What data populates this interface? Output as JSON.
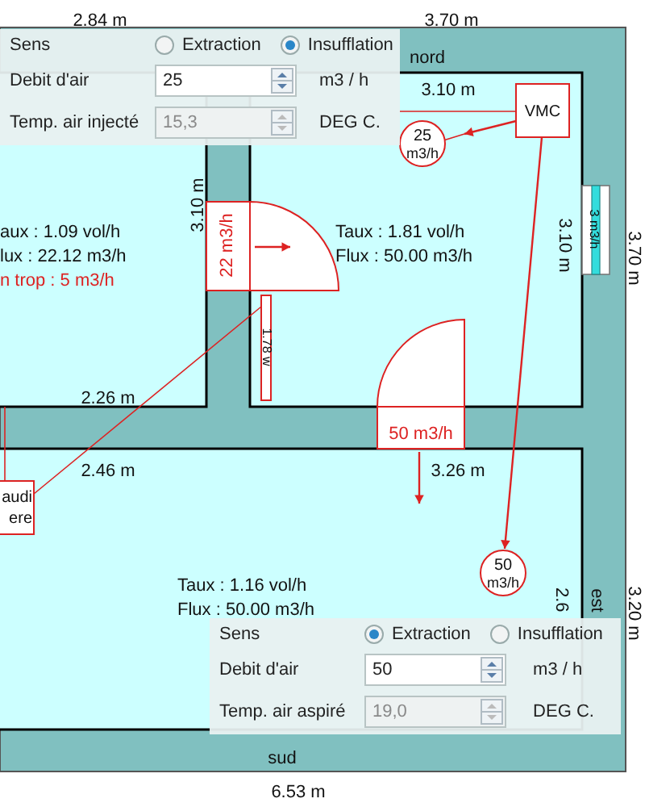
{
  "plan": {
    "dimension_labels": [
      "2.84 m",
      "3.70 m",
      "3.10 m",
      "3.10 m",
      "3.10 m",
      "3.70 m",
      "2.26 m",
      "2.46 m",
      "3.26 m",
      "2.6",
      "3.20 m",
      "6.53 m"
    ],
    "orientation_labels": [
      "nord",
      "sud",
      "est"
    ],
    "rooms": [
      {
        "lines": [
          {
            "text": "aux : 1.09 vol/h",
            "warning": false
          },
          {
            "text": "lux : 22.12 m3/h",
            "warning": false
          },
          {
            "text": "n trop : 5 m3/h",
            "warning": true
          }
        ]
      },
      {
        "lines": [
          {
            "text": "Taux : 1.81 vol/h",
            "warning": false
          },
          {
            "text": "Flux : 50.00 m3/h",
            "warning": false
          }
        ]
      },
      {
        "lines": [
          {
            "text": "Taux : 1.16 vol/h",
            "warning": false
          },
          {
            "text": "Flux : 50.00 m3/h",
            "warning": false
          }
        ]
      }
    ],
    "doors": [
      {
        "flow": "22 m3/h"
      },
      {
        "flow": "50 m3/h"
      }
    ],
    "heater": {
      "label": "1.78 w"
    },
    "window": {
      "flow": "3 m3/h"
    },
    "vmc": {
      "label": "VMC"
    },
    "flow_circles": [
      {
        "value": "25",
        "unit": "m3/h"
      },
      {
        "value": "50",
        "unit": "m3/h"
      }
    ],
    "boiler": {
      "lines": [
        "audi",
        "ere"
      ]
    }
  },
  "panels": [
    {
      "direction_label": "Sens",
      "options": [
        {
          "label": "Extraction",
          "selected": false
        },
        {
          "label": "Insufflation",
          "selected": true
        }
      ],
      "airflow": {
        "label": "Debit d'air",
        "value": "25",
        "unit": "m3 / h",
        "disabled": false
      },
      "temperature": {
        "label": "Temp. air injecté",
        "value": "15,3",
        "unit": "DEG C.",
        "disabled": true
      }
    },
    {
      "direction_label": "Sens",
      "options": [
        {
          "label": "Extraction",
          "selected": true
        },
        {
          "label": "Insufflation",
          "selected": false
        }
      ],
      "airflow": {
        "label": "Debit d'air",
        "value": "50",
        "unit": "m3 / h",
        "disabled": false
      },
      "temperature": {
        "label": "Temp. air aspiré",
        "value": "19,0",
        "unit": "DEG C.",
        "disabled": true
      }
    }
  ]
}
